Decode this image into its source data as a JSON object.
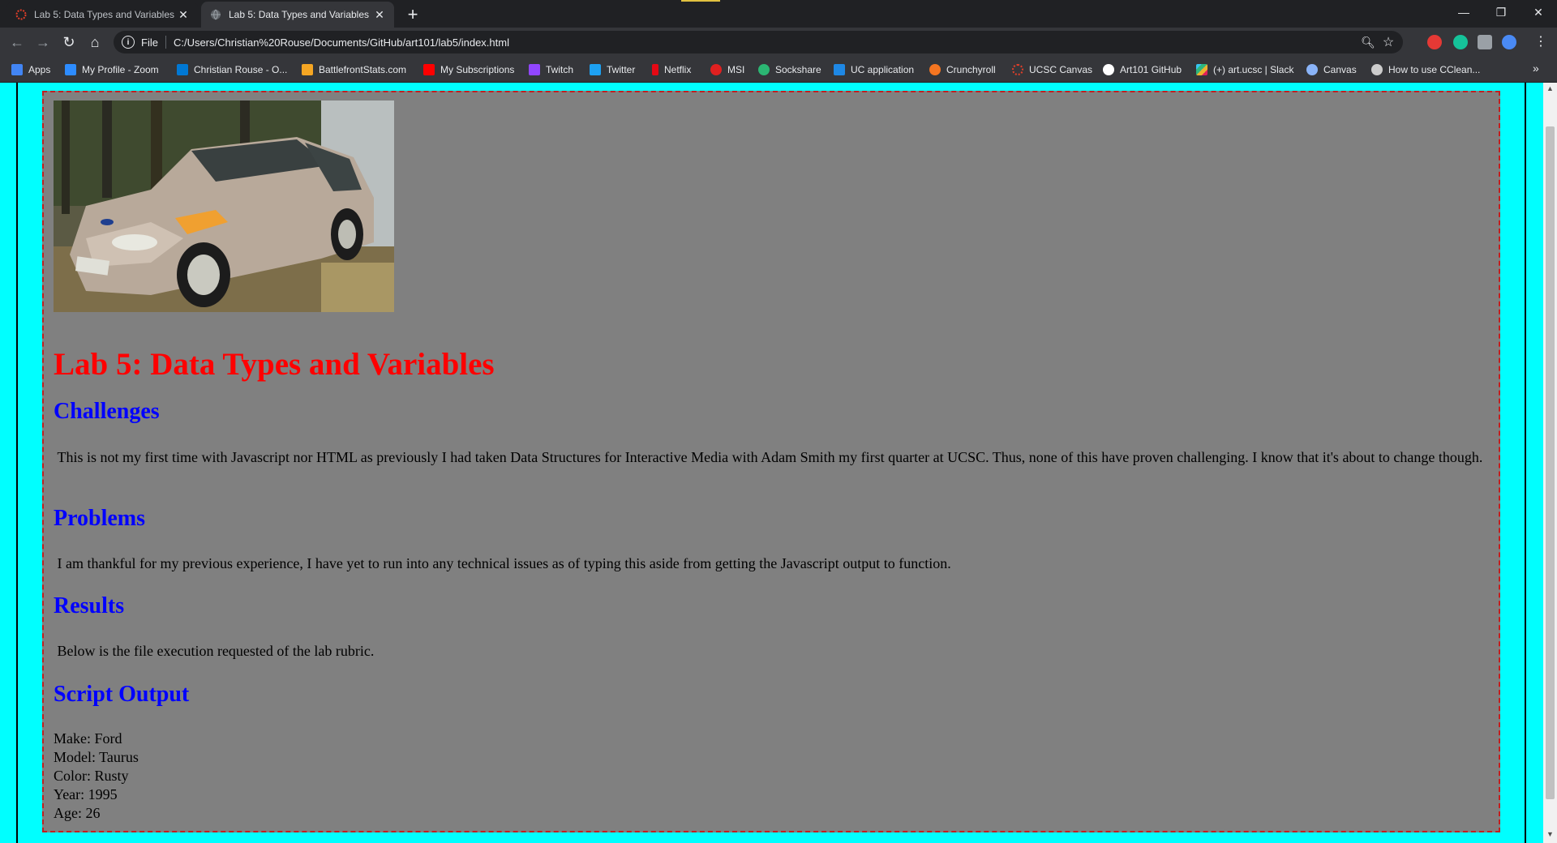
{
  "browser": {
    "tabs": [
      {
        "title": "Lab 5: Data Types and Variables",
        "active": false
      },
      {
        "title": "Lab 5: Data Types and Variables",
        "active": true
      }
    ],
    "scheme_label": "File",
    "url": "C:/Users/Christian%20Rouse/Documents/GitHub/art101/lab5/index.html"
  },
  "bookmarks": [
    {
      "label": "Apps",
      "icon": "apps-grid-icon",
      "color": "#4285f4"
    },
    {
      "label": "My Profile - Zoom",
      "icon": "zoom-icon",
      "color": "#2d8cff"
    },
    {
      "label": "Christian Rouse - O...",
      "icon": "outlook-icon",
      "color": "#0078d4"
    },
    {
      "label": "BattlefrontStats.com",
      "icon": "battlefront-icon",
      "color": "#f5a623"
    },
    {
      "label": "My Subscriptions",
      "icon": "youtube-icon",
      "color": "#ff0000"
    },
    {
      "label": "Twitch",
      "icon": "twitch-icon",
      "color": "#9146ff"
    },
    {
      "label": "Twitter",
      "icon": "twitter-icon",
      "color": "#1da1f2"
    },
    {
      "label": "Netflix",
      "icon": "netflix-icon",
      "color": "#e50914"
    },
    {
      "label": "MSI",
      "icon": "msi-icon",
      "color": "#e02020"
    },
    {
      "label": "Sockshare",
      "icon": "sockshare-icon",
      "color": "#2bb673"
    },
    {
      "label": "UC application",
      "icon": "uc-application-icon",
      "color": "#1e88e5"
    },
    {
      "label": "Crunchyroll",
      "icon": "crunchyroll-icon",
      "color": "#f47521"
    },
    {
      "label": "UCSC Canvas",
      "icon": "canvas-icon",
      "color": "#e13f29"
    },
    {
      "label": "Art101 GitHub",
      "icon": "github-icon",
      "color": "#ffffff"
    },
    {
      "label": "(+) art.ucsc | Slack",
      "icon": "slack-icon",
      "color": "#e01e5a"
    },
    {
      "label": "Canvas",
      "icon": "canvas-cloud-icon",
      "color": "#8ab4f8"
    },
    {
      "label": "How to use CClean...",
      "icon": "ccleaner-icon",
      "color": "#cccccc"
    }
  ],
  "page": {
    "image_alt": "car-photo",
    "title": "Lab 5: Data Types and Variables",
    "sections": [
      {
        "heading": "Challenges",
        "text": "This is not my first time with Javascript nor HTML as previously I had taken Data Structures for Interactive Media with Adam Smith my first quarter at UCSC. Thus, none of this have proven challenging. I know that it's about to change though."
      },
      {
        "heading": "Problems",
        "text": "I am thankful for my previous experience, I have yet to run into any technical issues as of typing this aside from getting the Javascript output to function."
      },
      {
        "heading": "Results",
        "text": "Below is the file execution requested of the lab rubric."
      },
      {
        "heading": "Script Output",
        "text": ""
      }
    ],
    "output": [
      "Make: Ford",
      "Model: Taurus",
      "Color: Rusty",
      "Year: 1995",
      "Age: 26"
    ]
  },
  "colors": {
    "page_background": "#00ffff",
    "card_background": "#808080",
    "card_border": "#c02020",
    "title": "#ff0000",
    "headings": "#0000ff"
  }
}
